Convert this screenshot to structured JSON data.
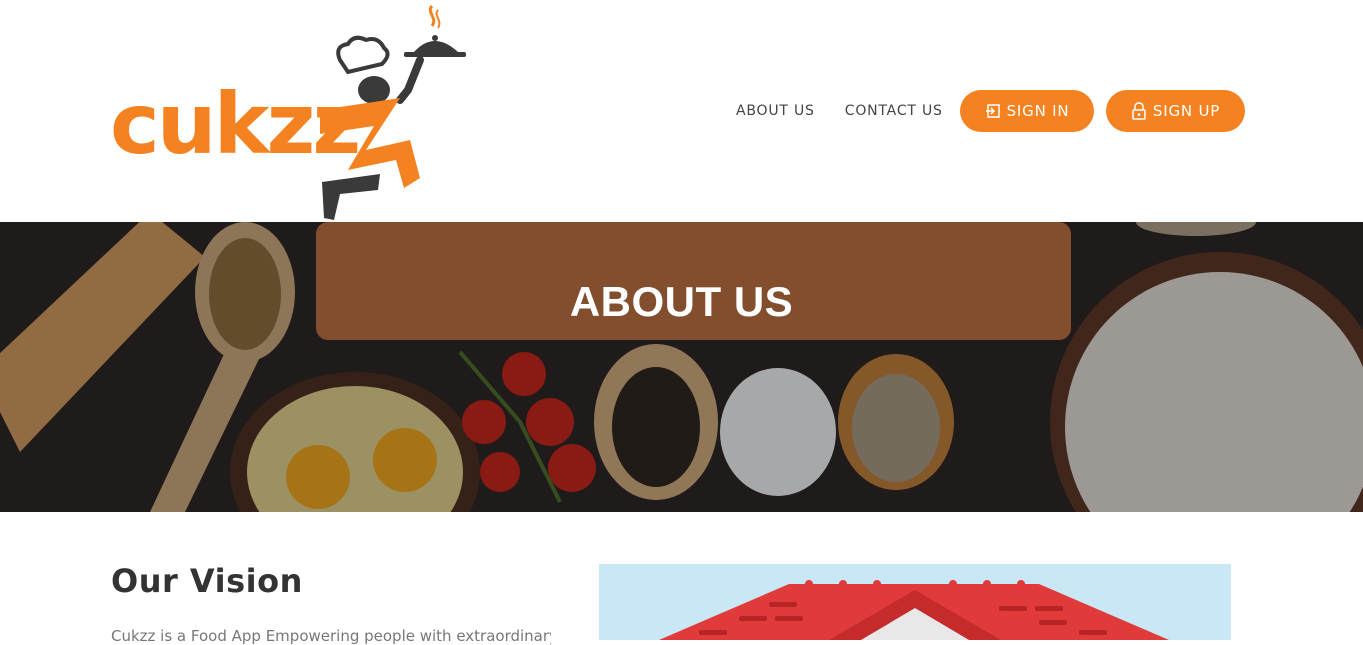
{
  "brand": {
    "name": "cukzz",
    "primary_color": "#f58220",
    "dark_color": "#3a3a3a"
  },
  "nav": {
    "about_label": "ABOUT US",
    "contact_label": "CONTACT US",
    "signin_label": "SIGN IN",
    "signup_label": "SIGN UP",
    "signin_icon": "sign-in-icon",
    "signup_icon": "lock-icon"
  },
  "hero": {
    "title": "ABOUT US"
  },
  "vision": {
    "title": "Our Vision",
    "text": "Cukzz is a Food App Empowering people with extraordinary"
  }
}
